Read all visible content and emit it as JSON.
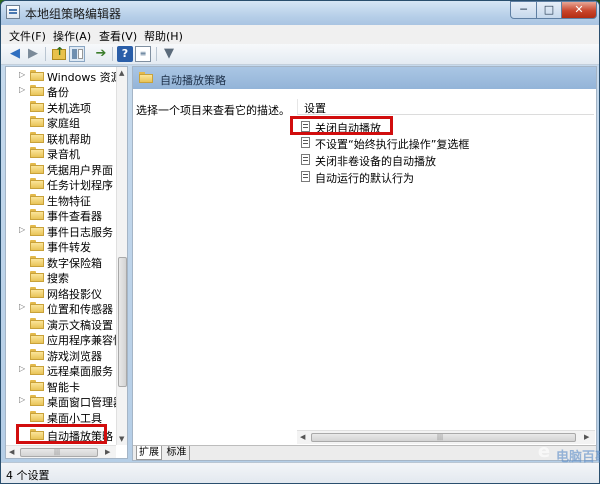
{
  "window": {
    "title": "本地组策略编辑器",
    "min_glyph": "─",
    "max_glyph": "□",
    "close_glyph": "✕"
  },
  "menu": [
    "文件(F)",
    "操作(A)",
    "查看(V)",
    "帮助(H)"
  ],
  "toolbar": {
    "back_glyph": "◀",
    "fwd_glyph": "▶",
    "export_glyph": "➔",
    "help_glyph": "?",
    "props_glyph": "≡",
    "filter_glyph": "▼"
  },
  "tree": {
    "items": [
      {
        "label": "Windows 资源管理器",
        "expander": "▷"
      },
      {
        "label": "备份",
        "expander": "▷"
      },
      {
        "label": "关机选项",
        "expander": ""
      },
      {
        "label": "家庭组",
        "expander": ""
      },
      {
        "label": "联机帮助",
        "expander": ""
      },
      {
        "label": "录音机",
        "expander": ""
      },
      {
        "label": "凭据用户界面",
        "expander": ""
      },
      {
        "label": "任务计划程序",
        "expander": ""
      },
      {
        "label": "生物特征",
        "expander": ""
      },
      {
        "label": "事件查看器",
        "expander": ""
      },
      {
        "label": "事件日志服务",
        "expander": "▷"
      },
      {
        "label": "事件转发",
        "expander": ""
      },
      {
        "label": "数字保险箱",
        "expander": ""
      },
      {
        "label": "搜索",
        "expander": ""
      },
      {
        "label": "网络投影仪",
        "expander": ""
      },
      {
        "label": "位置和传感器",
        "expander": "▷"
      },
      {
        "label": "演示文稿设置",
        "expander": ""
      },
      {
        "label": "应用程序兼容性",
        "expander": ""
      },
      {
        "label": "游戏浏览器",
        "expander": ""
      },
      {
        "label": "远程桌面服务",
        "expander": "▷"
      },
      {
        "label": "智能卡",
        "expander": ""
      },
      {
        "label": "桌面窗口管理器",
        "expander": "▷"
      },
      {
        "label": "桌面小工具",
        "expander": ""
      },
      {
        "label": "自动播放策略",
        "expander": ""
      }
    ],
    "scroll_up": "▲",
    "scroll_down": "▼",
    "scroll_left": "◀",
    "scroll_right": "▶",
    "grip": "|||"
  },
  "right": {
    "header_title": "自动播放策略",
    "description": "选择一个项目来查看它的描述。",
    "column_header": "设置",
    "settings": [
      "关闭自动播放",
      "不设置“始终执行此操作”复选框",
      "关闭非卷设备的自动播放",
      "自动运行的默认行为"
    ],
    "tabs": [
      "扩展",
      "标准"
    ],
    "scroll_left": "◀",
    "scroll_right": "▶",
    "grip": "|||"
  },
  "status": {
    "text": "4 个设置"
  },
  "watermark": {
    "logo": "e",
    "text": "电脑百事网"
  },
  "colors": {
    "highlight": "#d10d0d",
    "header": "#93b4d8"
  }
}
